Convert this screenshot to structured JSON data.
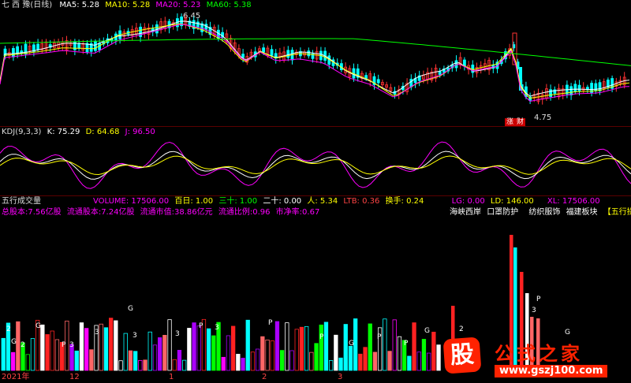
{
  "main_chart": {
    "title": "七 西 豫(日线)",
    "ma_labels": [
      {
        "text": "MA5: 5.28",
        "color": "#ffffff"
      },
      {
        "text": "MA10: 5.28",
        "color": "#ffff00"
      },
      {
        "text": "MA20: 5.23",
        "color": "#ff00ff"
      },
      {
        "text": "MA60: 5.38",
        "color": "#00ff00"
      }
    ],
    "high_mark": "6.45",
    "low_mark": "4.75",
    "badge_up": "涨",
    "badge_fin": "财",
    "colors": {
      "up": "#ff3333",
      "down": "#00ffff",
      "ma5": "#ffffff",
      "ma10": "#ffff00",
      "ma20": "#ff00ff",
      "ma60": "#00ff00"
    },
    "price_range": [
      4.6,
      6.6
    ]
  },
  "kdj": {
    "title": "KDJ(9,3,3)",
    "k_label": "K: 75.29",
    "d_label": "D: 64.68",
    "j_label": "J: 96.50",
    "colors": {
      "k": "#ffffff",
      "d": "#ffff00",
      "j": "#ff00ff"
    }
  },
  "volume_pane": {
    "title": "五行成交量",
    "stats": [
      {
        "text": "VOLUME: 17506.00",
        "color": "#ff00ff"
      },
      {
        "text": "百日: 1.00",
        "color": "#ffff00"
      },
      {
        "text": "三十: 1.00",
        "color": "#00ff00"
      },
      {
        "text": "二十: 0.00",
        "color": "#ffffff"
      },
      {
        "text": "人: 5.34",
        "color": "#ffff00"
      },
      {
        "text": "LTB: 0.36",
        "color": "#ff4444"
      },
      {
        "text": "换手: 0.24",
        "color": "#ffff00"
      },
      {
        "text": "LG: 0.00",
        "color": "#ff00ff"
      },
      {
        "text": "LD: 146.00",
        "color": "#ffff00"
      },
      {
        "text": "XL: 17506.00",
        "color": "#ff00ff"
      }
    ],
    "info": [
      "总股本:7.56亿股",
      "流通股本:7.24亿股",
      "流通市值:38.86亿元",
      "流通比例:0.96",
      "市净率:0.67"
    ],
    "sectors": [
      "海峡西岸",
      "口罩防护",
      "纺织服饰",
      "福建板块"
    ],
    "panel_link": "【五行操盘】"
  },
  "time_axis": [
    "2021年",
    "12",
    "1",
    "2",
    "3"
  ],
  "watermark": {
    "icon_char": "股",
    "text": "公式之家",
    "url": "www.gszj100.com"
  }
}
